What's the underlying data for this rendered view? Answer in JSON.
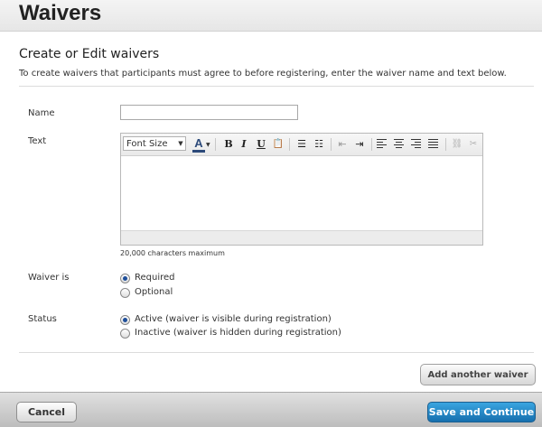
{
  "page": {
    "title": "Waivers"
  },
  "section": {
    "title": "Create or Edit waivers",
    "description": "To create waivers that participants must agree to before registering, enter the waiver name and text below."
  },
  "form": {
    "name_label": "Name",
    "name_value": "",
    "text_label": "Text",
    "editor": {
      "font_size_label": "Font Size",
      "bold": "B",
      "italic": "I",
      "underline": "U",
      "color_glyph": "A",
      "content": ""
    },
    "char_limit": "20,000 characters maximum",
    "waiver_is_label": "Waiver is",
    "waiver_options": [
      {
        "label": "Required",
        "checked": true
      },
      {
        "label": "Optional",
        "checked": false
      }
    ],
    "status_label": "Status",
    "status_options": [
      {
        "label": "Active (waiver is visible during registration)",
        "checked": true
      },
      {
        "label": "Inactive (waiver is hidden during registration)",
        "checked": false
      }
    ]
  },
  "buttons": {
    "add_another": "Add another waiver",
    "cancel": "Cancel",
    "save_continue": "Save and Continue"
  },
  "colors": {
    "primary_button": "#166fae",
    "radio_checked": "#1f4f9a"
  }
}
